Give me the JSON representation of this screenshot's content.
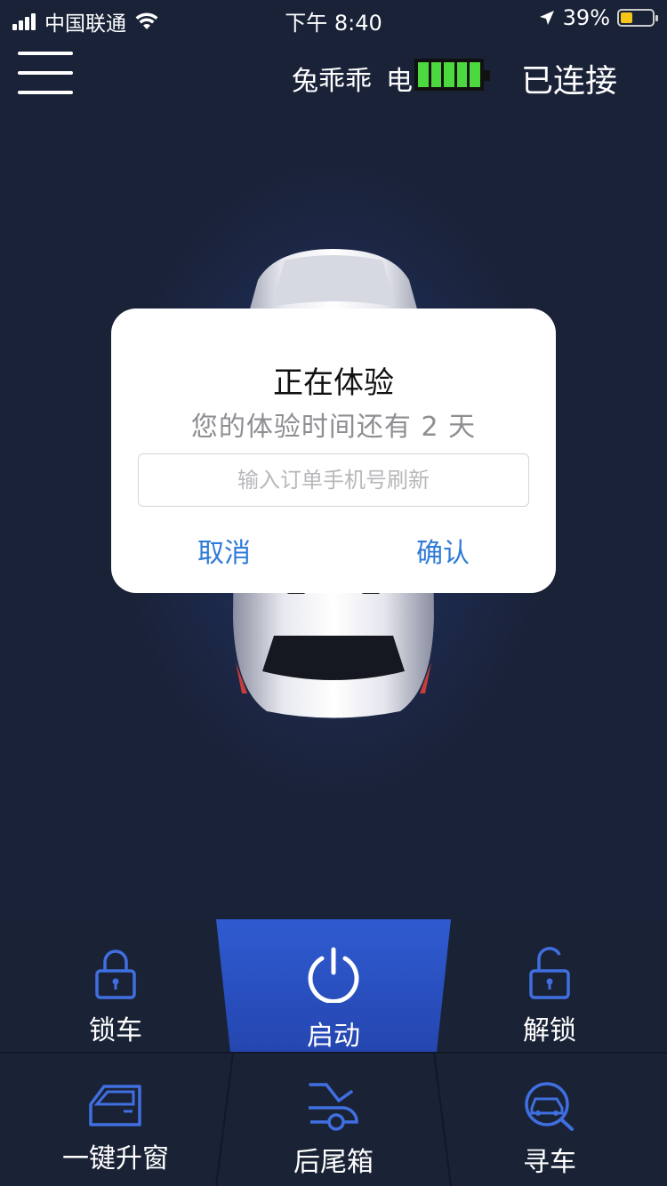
{
  "status_bar": {
    "carrier": "中国联通",
    "time": "下午 8:40",
    "battery_percent": "39%",
    "battery_level": 0.39,
    "icons": [
      "signal-icon",
      "wifi-icon",
      "location-arrow-icon",
      "battery-icon"
    ]
  },
  "header": {
    "menu_icon": "hamburger-icon",
    "device_name": "兔乖乖",
    "power_label": "电",
    "car_battery_level": 1.0,
    "car_battery_color": "#4cd93f",
    "connection_status": "已连接"
  },
  "dialog": {
    "title": "正在体验",
    "message": "您的体验时间还有 2 天",
    "input_placeholder": "输入订单手机号刷新",
    "input_value": "",
    "cancel_label": "取消",
    "confirm_label": "确认",
    "button_color": "#2f7bd8"
  },
  "controls": {
    "lock": {
      "label": "锁车",
      "icon": "lock-icon"
    },
    "start": {
      "label": "启动",
      "icon": "power-icon",
      "active": true
    },
    "unlock": {
      "label": "解锁",
      "icon": "unlock-icon"
    },
    "window": {
      "label": "一键升窗",
      "icon": "car-window-icon"
    },
    "trunk": {
      "label": "后尾箱",
      "icon": "trunk-icon"
    },
    "find": {
      "label": "寻车",
      "icon": "find-car-icon"
    }
  },
  "colors": {
    "background": "#1a2238",
    "accent_blue": "#2e56c8",
    "icon_blue": "#3f6fe0"
  }
}
